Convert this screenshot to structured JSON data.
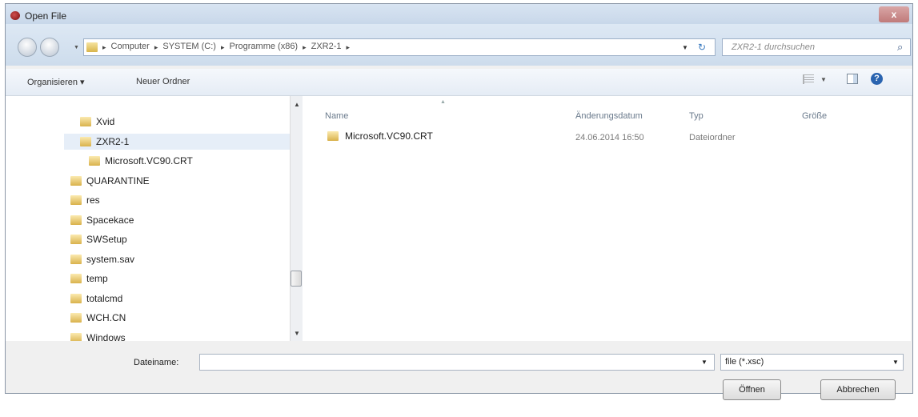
{
  "window": {
    "title": "Open File",
    "close_label": "x"
  },
  "address": {
    "crumbs": [
      "Computer",
      "SYSTEM (C:)",
      "Programme (x86)",
      "ZXR2-1"
    ],
    "separator": "▸"
  },
  "search": {
    "placeholder": "ZXR2-1 durchsuchen"
  },
  "toolbar": {
    "organize_label": "Organisieren ▾",
    "new_folder_label": "Neuer Ordner",
    "help_label": "?"
  },
  "nav_tree": [
    {
      "label": "Xvid",
      "selected": false,
      "indent": 1
    },
    {
      "label": "ZXR2-1",
      "selected": true,
      "indent": 1
    },
    {
      "label": "Microsoft.VC90.CRT",
      "selected": false,
      "indent": 2
    },
    {
      "label": "QUARANTINE",
      "selected": false,
      "indent": 0
    },
    {
      "label": "res",
      "selected": false,
      "indent": 0
    },
    {
      "label": "Spacekace",
      "selected": false,
      "indent": 0
    },
    {
      "label": "SWSetup",
      "selected": false,
      "indent": 0
    },
    {
      "label": "system.sav",
      "selected": false,
      "indent": 0
    },
    {
      "label": "temp",
      "selected": false,
      "indent": 0
    },
    {
      "label": "totalcmd",
      "selected": false,
      "indent": 0
    },
    {
      "label": "WCH.CN",
      "selected": false,
      "indent": 0
    },
    {
      "label": "Windows",
      "selected": false,
      "indent": 0
    }
  ],
  "file_list": {
    "columns": {
      "name": "Name",
      "date": "Änderungsdatum",
      "type": "Typ",
      "size": "Größe"
    },
    "rows": [
      {
        "name": "Microsoft.VC90.CRT",
        "date": "24.06.2014 16:50",
        "type": "Dateiordner",
        "size": ""
      }
    ]
  },
  "bottom": {
    "filename_label": "Dateiname:",
    "filename_value": "",
    "filter_value": "file (*.xsc)",
    "open_label": "Öffnen",
    "cancel_label": "Abbrechen"
  }
}
